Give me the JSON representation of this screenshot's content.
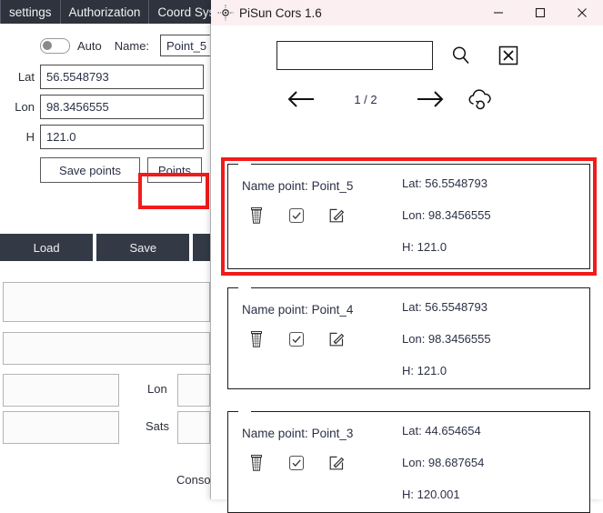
{
  "background_app": {
    "tabs": [
      {
        "label": "settings"
      },
      {
        "label": "Authorization"
      },
      {
        "label": "Coord System"
      }
    ],
    "auto_toggle": {
      "label": "Auto",
      "state": "off"
    },
    "name_label": "Name:",
    "name_value": "Point_5",
    "fields": [
      {
        "label": "Lat",
        "value": "56.5548793"
      },
      {
        "label": "Lon",
        "value": "98.3456555"
      },
      {
        "label": "H",
        "value": "121.0"
      }
    ],
    "save_points_label": "Save points",
    "points_label": "Points",
    "load_label": "Load",
    "save_label": "Save",
    "lon_label": "Lon",
    "sats_label": "Sats",
    "console_label": "Conso",
    "highlight_color": "#f21b1b"
  },
  "pisun_window": {
    "title": "PiSun Cors 1.6",
    "app_icon": "crosshair-icon",
    "window_controls": {
      "minimize": "—",
      "maximize": "☐",
      "close": "✕"
    },
    "titlebar_color": "#fbeff1",
    "toolbar": {
      "search_value": "",
      "search_placeholder": "",
      "search_icon": "search-icon",
      "clear_icon": "clear-boxed-x-icon",
      "prev_icon": "arrow-left-icon",
      "next_icon": "arrow-right-icon",
      "sync_icon": "cloud-sync-icon",
      "page_indicator": "1 / 2"
    },
    "points": [
      {
        "name_label": "Name point:",
        "name": "Point_5",
        "lat": "Lat: 56.5548793",
        "lon": "Lon: 98.3456555",
        "h": "H: 121.0",
        "delete_icon": "trash-icon",
        "select_icon": "checkbox-checked-icon",
        "edit_icon": "edit-pencil-icon",
        "highlighted": true
      },
      {
        "name_label": "Name point:",
        "name": "Point_4",
        "lat": "Lat: 56.5548793",
        "lon": "Lon: 98.3456555",
        "h": "H: 121.0",
        "delete_icon": "trash-icon",
        "select_icon": "checkbox-checked-icon",
        "edit_icon": "edit-pencil-icon",
        "highlighted": false
      },
      {
        "name_label": "Name point:",
        "name": "Point_3",
        "lat": "Lat: 44.654654",
        "lon": "Lon: 98.687654",
        "h": "H: 120.001",
        "delete_icon": "trash-icon",
        "select_icon": "checkbox-checked-icon",
        "edit_icon": "edit-pencil-icon",
        "highlighted": false
      }
    ]
  }
}
